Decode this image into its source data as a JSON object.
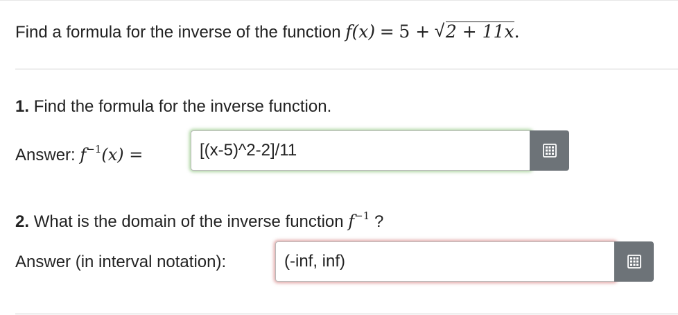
{
  "problem": {
    "prefix": "Find a formula for the inverse of the function",
    "f_of_x": "f(x)",
    "equals": "=",
    "five_plus": "5 +",
    "sqrt_arg": "2 + 11x",
    "period": "."
  },
  "part1": {
    "number": "1.",
    "text": "Find the formula for the inverse function.",
    "answer_prefix": "Answer:",
    "answer_f": "f",
    "answer_exp": "−1",
    "answer_arg": "(x) =",
    "value": "[(x-5)^2-2]/11",
    "status": "correct",
    "status_color": "#6eb45a"
  },
  "part2": {
    "number": "2.",
    "text_before": "What is the domain of the inverse function",
    "text_f": "f",
    "text_exp": "−1",
    "text_after": "?",
    "answer_label": "Answer (in interval notation):",
    "value": "(-inf, inf)",
    "status": "incorrect",
    "status_color": "#c85a5a"
  },
  "icons": {
    "palette": "equation-palette-icon"
  }
}
